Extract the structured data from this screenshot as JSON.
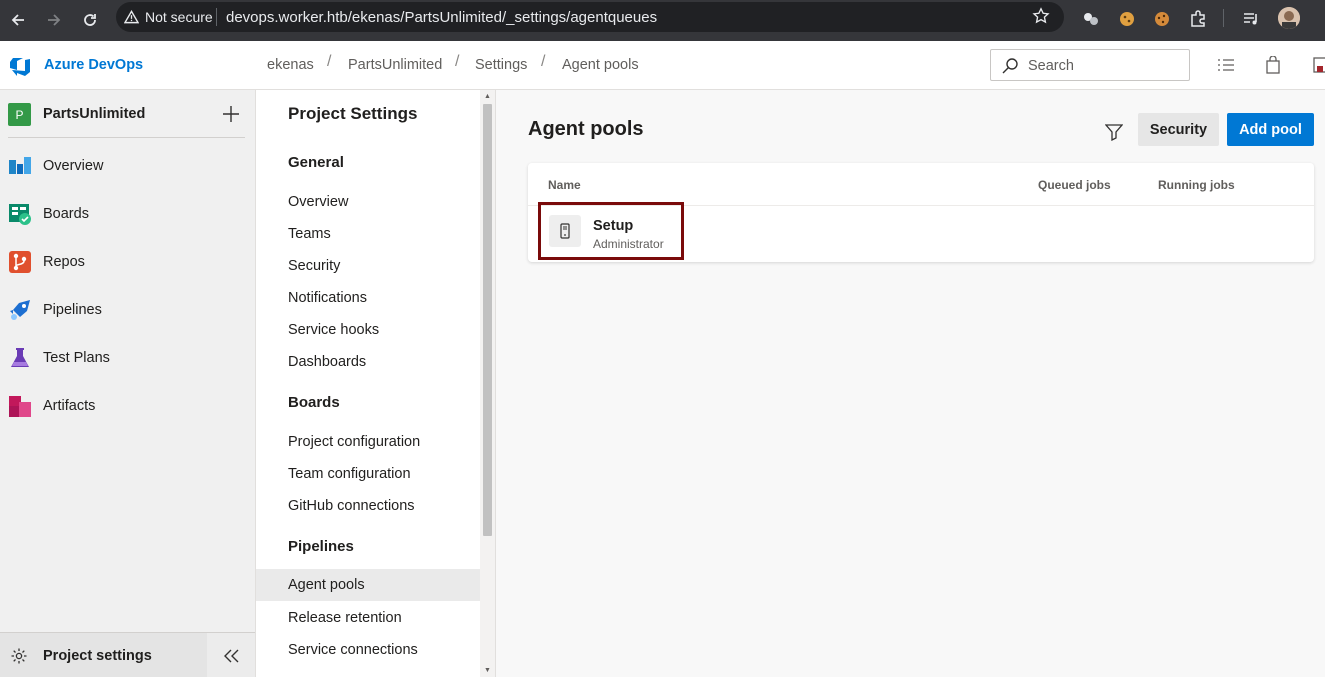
{
  "browser": {
    "security_label": "Not secure",
    "url": "devops.worker.htb/ekenas/PartsUnlimited/_settings/agentqueues"
  },
  "header": {
    "brand": "Azure DevOps",
    "breadcrumbs": [
      "ekenas",
      "PartsUnlimited",
      "Settings",
      "Agent pools"
    ],
    "search_placeholder": "Search"
  },
  "project": {
    "initial": "P",
    "name": "PartsUnlimited",
    "badge_color": "#339947"
  },
  "nav": {
    "items": [
      {
        "label": "Overview",
        "icon": "overview-icon"
      },
      {
        "label": "Boards",
        "icon": "boards-icon"
      },
      {
        "label": "Repos",
        "icon": "repos-icon"
      },
      {
        "label": "Pipelines",
        "icon": "pipelines-icon"
      },
      {
        "label": "Test Plans",
        "icon": "test-plans-icon"
      },
      {
        "label": "Artifacts",
        "icon": "artifacts-icon"
      }
    ],
    "settings_label": "Project settings"
  },
  "settings": {
    "title": "Project Settings",
    "groups": [
      {
        "label": "General",
        "items": [
          "Overview",
          "Teams",
          "Security",
          "Notifications",
          "Service hooks",
          "Dashboards"
        ]
      },
      {
        "label": "Boards",
        "items": [
          "Project configuration",
          "Team configuration",
          "GitHub connections"
        ]
      },
      {
        "label": "Pipelines",
        "items": [
          "Agent pools",
          "Release retention",
          "Service connections"
        ]
      }
    ],
    "selected": "Agent pools"
  },
  "main": {
    "title": "Agent pools",
    "security_button": "Security",
    "add_button": "Add pool",
    "columns": [
      "Name",
      "Queued jobs",
      "Running jobs"
    ],
    "pools": [
      {
        "name": "Setup",
        "owner": "Administrator"
      }
    ]
  },
  "colors": {
    "accent": "#0078d4",
    "highlight_border": "#7a0a0a"
  }
}
